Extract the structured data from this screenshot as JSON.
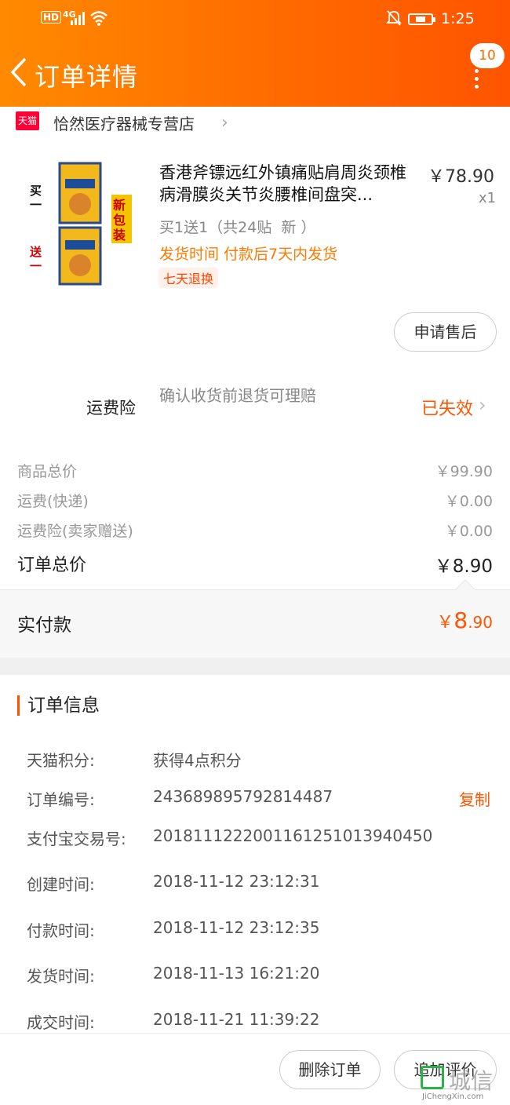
{
  "status": {
    "hd": "HD",
    "signal": "4G",
    "time": "1:25"
  },
  "header": {
    "title": "订单详情",
    "badge_count": "10"
  },
  "shop": {
    "tmall": "天猫",
    "name": "恰然医疗器械专营店"
  },
  "product": {
    "title": "香港斧镖远红外镇痛贴肩周炎颈椎病滑膜炎关节炎腰椎间盘突...",
    "thumb_left_top": "买一",
    "thumb_left_bottom": "送一",
    "thumb_badge": "新包装",
    "price": "￥78.90",
    "qty": "x1",
    "sku": "买1送1（共24贴  新 ）",
    "ship_label": "发货时间 付款后7天内发货",
    "tag": "七天退换",
    "after_sale_button": "申请售后"
  },
  "insurance": {
    "label": "运费险",
    "desc": "确认收货前退货可理赔",
    "status": "已失效"
  },
  "costs": [
    {
      "label": "商品总价",
      "value": "￥99.90"
    },
    {
      "label": "运费(快递)",
      "value": "￥0.00"
    },
    {
      "label": "运费险(卖家赠送)",
      "value": "￥0.00"
    }
  ],
  "order_total": {
    "label": "订单总价",
    "value": "￥8.90"
  },
  "paid": {
    "label": "实付款",
    "currency": "￥",
    "integer": "8",
    "decimal": ".90"
  },
  "order_info": {
    "title": "订单信息",
    "rows": [
      {
        "label": "天猫积分:",
        "value": "获得4点积分"
      },
      {
        "label": "订单编号:",
        "value": "243689895792814487"
      },
      {
        "label": "支付宝交易号:",
        "value": "2018111222001161251013940450"
      },
      {
        "label": "创建时间:",
        "value": "2018-11-12 23:12:31"
      },
      {
        "label": "付款时间:",
        "value": "2018-11-12 23:12:35"
      },
      {
        "label": "发货时间:",
        "value": "2018-11-13 16:21:20"
      },
      {
        "label": "成交时间:",
        "value": "2018-11-21 11:39:22"
      }
    ],
    "copy_label": "复制"
  },
  "actions": {
    "delete": "删除订单",
    "review": "追加评价"
  },
  "watermark": {
    "text": "城信",
    "url": "JiChengXin.com"
  },
  "colors": {
    "header_start": "#ff8a00",
    "header_end": "#ff5400",
    "accent": "#ff5500",
    "tmall_red": "#ff0036"
  }
}
